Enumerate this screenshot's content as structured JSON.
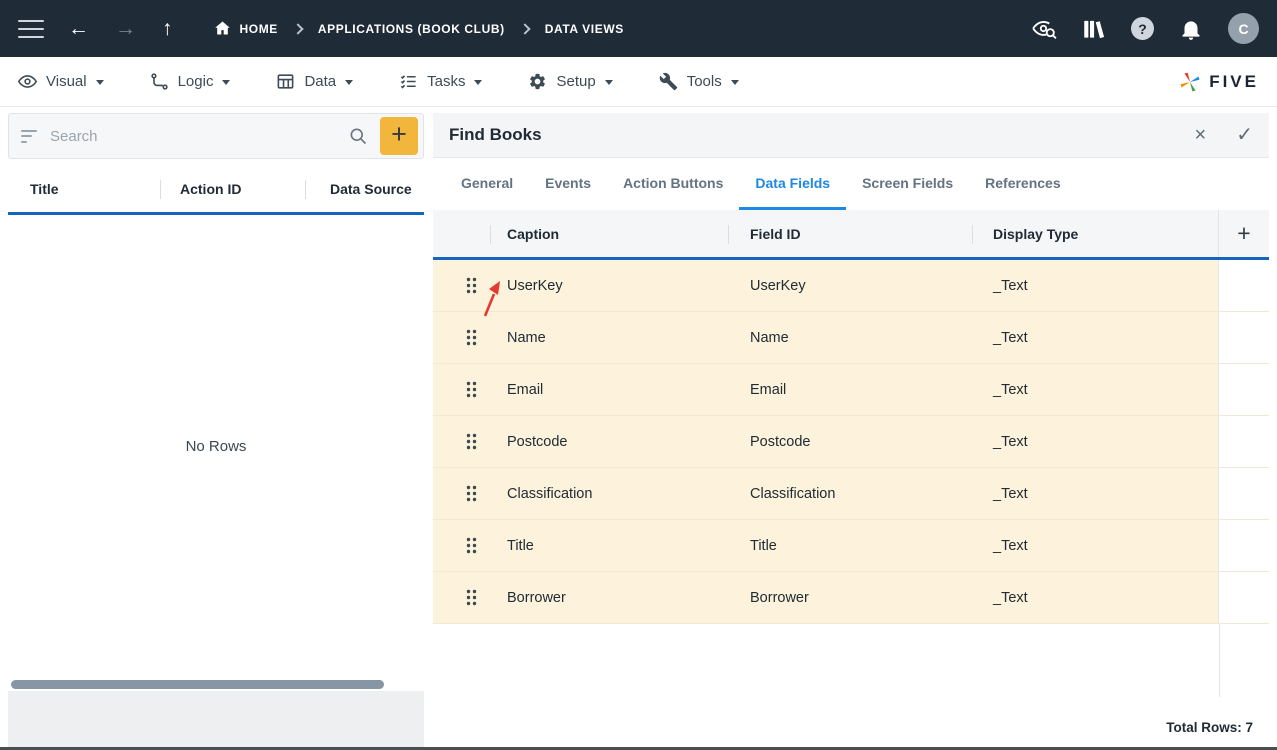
{
  "topbar": {
    "icons": {
      "back": "←",
      "forward": "→",
      "up": "↑"
    },
    "breadcrumb": {
      "home": "HOME",
      "level1": "APPLICATIONS (BOOK CLUB)",
      "level2": "DATA VIEWS"
    },
    "help_glyph": "?",
    "avatar_initial": "C"
  },
  "menubar": {
    "caret": "",
    "items": [
      {
        "label": "Visual",
        "icon": "eye-icon"
      },
      {
        "label": "Logic",
        "icon": "logic-branch-icon"
      },
      {
        "label": "Data",
        "icon": "table-grid-icon"
      },
      {
        "label": "Tasks",
        "icon": "checklist-icon"
      },
      {
        "label": "Setup",
        "icon": "gear-icon"
      },
      {
        "label": "Tools",
        "icon": "wrench-icon"
      }
    ],
    "brand": "FIVE"
  },
  "left_panel": {
    "search": {
      "placeholder": "Search"
    },
    "add_button": "+",
    "columns": [
      "Title",
      "Action ID",
      "Data Source"
    ],
    "empty_text": "No Rows"
  },
  "right_panel": {
    "title": "Find Books",
    "close_icon": "×",
    "confirm_icon": "✓",
    "tabs": [
      "General",
      "Events",
      "Action Buttons",
      "Data Fields",
      "Screen Fields",
      "References"
    ],
    "active_tab": "Data Fields",
    "table": {
      "columns": [
        "Caption",
        "Field ID",
        "Display Type"
      ],
      "add_button": "+",
      "rows": [
        {
          "caption": "UserKey",
          "field_id": "UserKey",
          "display_type": "_Text"
        },
        {
          "caption": "Name",
          "field_id": "Name",
          "display_type": "_Text"
        },
        {
          "caption": "Email",
          "field_id": "Email",
          "display_type": "_Text"
        },
        {
          "caption": "Postcode",
          "field_id": "Postcode",
          "display_type": "_Text"
        },
        {
          "caption": "Classification",
          "field_id": "Classification",
          "display_type": "_Text"
        },
        {
          "caption": "Title",
          "field_id": "Title",
          "display_type": "_Text"
        },
        {
          "caption": "Borrower",
          "field_id": "Borrower",
          "display_type": "_Text"
        }
      ]
    },
    "total_rows": "Total Rows: 7"
  },
  "colors": {
    "topbar_bg": "#202b38",
    "accent_yellow": "#f2b63c",
    "active_tab_blue": "#1e88e5",
    "header_underline_blue": "#1565c0",
    "row_bg": "#fdf3dc",
    "annotation_red": "#e8392e"
  }
}
